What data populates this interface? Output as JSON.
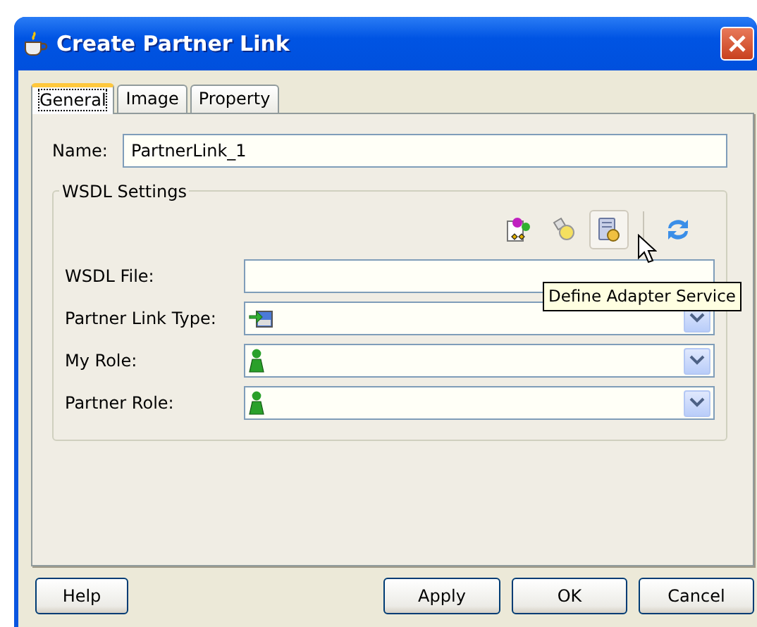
{
  "window": {
    "title": "Create Partner Link"
  },
  "tabs": [
    {
      "label": "General",
      "selected": true
    },
    {
      "label": "Image",
      "selected": false
    },
    {
      "label": "Property",
      "selected": false
    }
  ],
  "name_field": {
    "label": "Name:",
    "value": "PartnerLink_1"
  },
  "wsdl_settings": {
    "title": "WSDL Settings",
    "toolbar": [
      {
        "kind": "service",
        "hovered": false
      },
      {
        "kind": "flashlight",
        "hovered": false
      },
      {
        "kind": "adapter",
        "hovered": true
      },
      {
        "kind": "separator"
      },
      {
        "kind": "refresh",
        "hovered": false
      }
    ],
    "tooltip": "Define Adapter Service",
    "fields": [
      {
        "kind": "text",
        "label": "WSDL File:"
      },
      {
        "kind": "link-type-combo",
        "label": "Partner Link Type:"
      },
      {
        "kind": "role-combo",
        "label": "My Role:"
      },
      {
        "kind": "role-combo",
        "label": "Partner Role:"
      }
    ]
  },
  "buttons": [
    {
      "label": "Help"
    },
    {
      "label": "Apply"
    },
    {
      "label": "OK"
    },
    {
      "label": "Cancel"
    }
  ]
}
